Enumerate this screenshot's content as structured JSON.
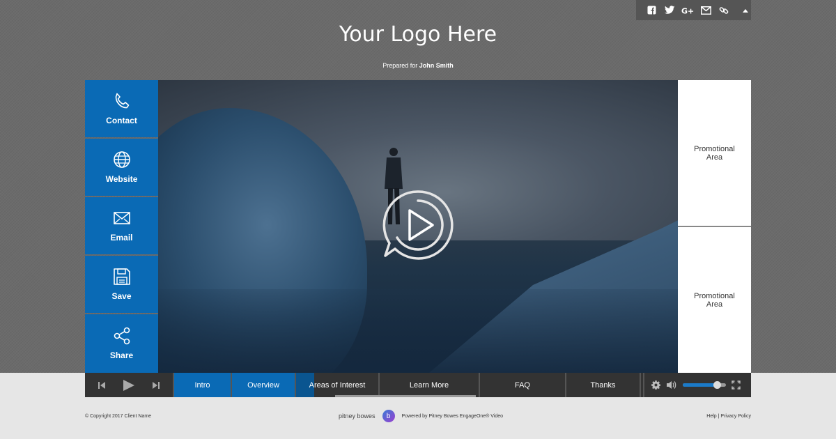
{
  "header": {
    "logo_text": "Your Logo Here",
    "prepared_prefix": "Prepared for",
    "prepared_name": "John Smith"
  },
  "social": {
    "icons": [
      "facebook-icon",
      "twitter-icon",
      "google-plus-icon",
      "email-icon",
      "link-icon",
      "collapse-icon"
    ]
  },
  "sidebar": {
    "items": [
      {
        "label": "Contact",
        "icon": "phone-icon"
      },
      {
        "label": "Website",
        "icon": "globe-icon"
      },
      {
        "label": "Email",
        "icon": "envelope-icon"
      },
      {
        "label": "Save",
        "icon": "floppy-disk-icon"
      },
      {
        "label": "Share",
        "icon": "share-icon"
      }
    ]
  },
  "promo": {
    "top": "Promotional Area",
    "bottom": "Promotional Area"
  },
  "player": {
    "chapters": [
      "Intro",
      "Overview",
      "Areas of Interest",
      "Learn More",
      "FAQ",
      "Thanks"
    ],
    "active_chapter": "Areas of Interest",
    "volume": 0.8
  },
  "footer": {
    "copyright": "© Copyright 2017 Client Name",
    "brand": "pitney bowes",
    "powered": "Powered by Pitney Bowes EngageOne® Video",
    "help": "Help",
    "separator": "|",
    "privacy": "Privacy Policy"
  },
  "colors": {
    "accent": "#0a6ab5",
    "control_bar": "#333333",
    "background": "#6b6b6b"
  }
}
